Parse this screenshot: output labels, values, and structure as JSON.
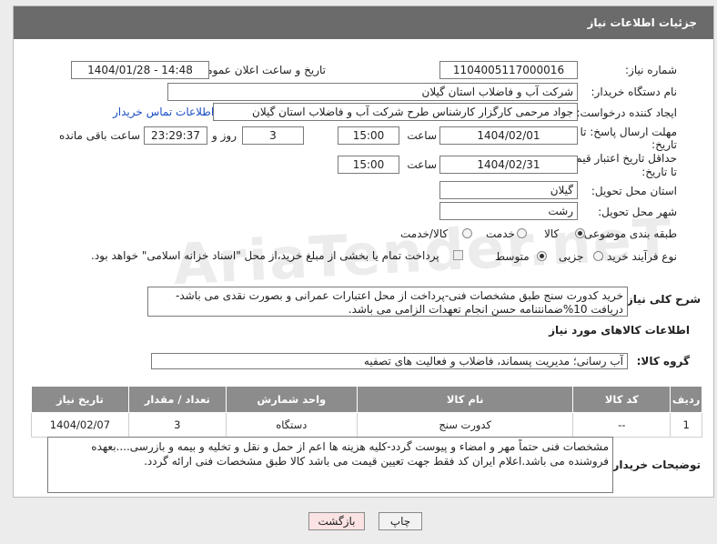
{
  "header": {
    "title": "جزئیات اطلاعات نیاز"
  },
  "fields": {
    "need_number_label": "شماره نیاز:",
    "need_number": "1104005117000016",
    "announce_label": "تاریخ و ساعت اعلان عمومی:",
    "announce_value": "1404/01/28 - 14:48",
    "buyer_org_label": "نام دستگاه خریدار:",
    "buyer_org": "شرکت آب و فاضلاب استان گیلان",
    "creator_label": "ایجاد کننده درخواست:",
    "creator": "جواد مرحمی کارگزار کارشناس طرح شرکت آب و فاضلاب استان گیلان",
    "contact_link": "اطلاعات تماس خریدار",
    "reply_deadline_label_1": "مهلت ارسال پاسخ: تا",
    "reply_deadline_label_2": "تاریخ:",
    "reply_date": "1404/02/01",
    "time_label": "ساعت",
    "reply_time": "15:00",
    "days_value": "3",
    "days_label": "روز و",
    "remaining_value": "23:29:37",
    "remaining_label": "ساعت باقی مانده",
    "price_deadline_label_1": "حداقل تاریخ اعتبار قیمت:",
    "price_deadline_label_2": "تا تاریخ:",
    "price_date": "1404/02/31",
    "price_time": "15:00",
    "province_label": "استان محل تحویل:",
    "province": "گیلان",
    "city_label": "شهر محل تحویل:",
    "city": "رشت",
    "category_label": "طبقه بندی موضوعی:",
    "category_options": [
      "کالا",
      "خدمت",
      "کالا/خدمت"
    ],
    "process_label": "نوع فرآیند خرید :",
    "process_options": [
      "جزیی",
      "متوسط"
    ],
    "payment_note": "پرداخت تمام یا بخشی از مبلغ خرید،از محل \"اسناد خزانه اسلامی\" خواهد بود."
  },
  "description": {
    "label": "شرح کلی نیاز:",
    "text": "خرید کدورت سنج طبق مشخصات فنی-پرداخت از محل اعتبارات عمرانی و بصورت نقدی می باشد-دریافت 10%ضمانتنامه حسن انجام تعهدات الزامی می باشد."
  },
  "goods": {
    "section_title": "اطلاعات کالاهای مورد نیاز",
    "group_label": "گروه کالا:",
    "group_value": "آب رسانی؛ مدیریت پسماند، فاضلاب و فعالیت های تصفیه",
    "columns": [
      "ردیف",
      "کد کالا",
      "نام کالا",
      "واحد شمارش",
      "تعداد / مقدار",
      "تاریخ نیاز"
    ],
    "rows": [
      {
        "row": "1",
        "code": "--",
        "name": "کدورت سنج",
        "unit": "دستگاه",
        "qty": "3",
        "date": "1404/02/07"
      }
    ]
  },
  "buyer_notes": {
    "label": "توضیحات خریدار:",
    "text": "مشخصات فنی حتماً مهر و امضاء و پیوست گردد-کلیه هزینه ها اعم از حمل و نقل و تخلیه و بیمه و بازرسی....بعهده فروشنده می باشد.اعلام ایران کد فقط جهت تعیین قیمت می باشد کالا طبق مشخصات فنی ارائه گردد."
  },
  "buttons": {
    "print": "چاپ",
    "back": "بازگشت"
  },
  "watermark": "AriaTender.neT",
  "colors": {
    "header_bg": "#6b6b6b",
    "table_header_bg": "#8c8c8c",
    "back_button_bg": "#fbe3e3",
    "link": "#1a4fc4"
  }
}
